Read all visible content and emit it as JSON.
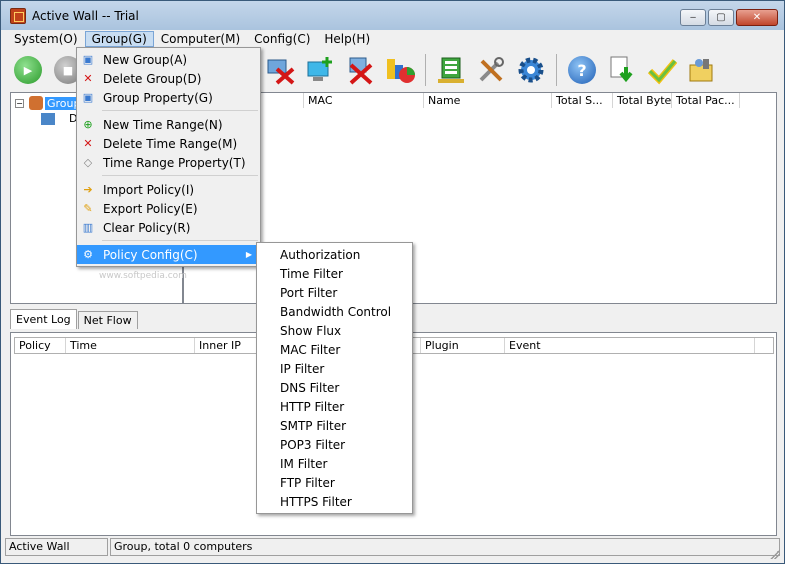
{
  "window": {
    "title": "Active Wall -- Trial",
    "min": "‒",
    "max": "▢",
    "close": "✕"
  },
  "menubar": [
    "System(O)",
    "Group(G)",
    "Computer(M)",
    "Config(C)",
    "Help(H)"
  ],
  "tree": {
    "root": "Group",
    "child": "D"
  },
  "list_columns": [
    "",
    "MAC",
    "Name",
    "Total S...",
    "Total Byte",
    "Total Pac..."
  ],
  "group_menu": {
    "items": [
      {
        "label": "New Group(A)",
        "icon": "group-add-icon"
      },
      {
        "label": "Delete Group(D)",
        "icon": "group-delete-icon"
      },
      {
        "label": "Group Property(G)",
        "icon": "group-property-icon"
      },
      {
        "label": "New Time Range(N)",
        "icon": "time-add-icon"
      },
      {
        "label": "Delete Time Range(M)",
        "icon": "time-delete-icon"
      },
      {
        "label": "Time Range Property(T)",
        "icon": "time-property-icon"
      },
      {
        "label": "Import Policy(I)",
        "icon": "import-icon"
      },
      {
        "label": "Export Policy(E)",
        "icon": "export-icon"
      },
      {
        "label": "Clear Policy(R)",
        "icon": "trash-icon"
      },
      {
        "label": "Policy Config(C)",
        "icon": "gear-icon"
      }
    ]
  },
  "policy_submenu": [
    "Authorization",
    "Time Filter",
    "Port Filter",
    "Bandwidth Control",
    "Show Flux",
    "MAC Filter",
    "IP Filter",
    "DNS Filter",
    "HTTP Filter",
    "SMTP Filter",
    "POP3 Filter",
    "IM Filter",
    "FTP Filter",
    "HTTPS Filter"
  ],
  "tabs": [
    "Event Log",
    "Net Flow"
  ],
  "log_columns": [
    "Policy",
    "Time",
    "Inner IP",
    "",
    "Plugin",
    "Event"
  ],
  "status": {
    "left": "Active Wall",
    "right": "Group, total 0 computers"
  },
  "watermark": "www.softpedia.com"
}
